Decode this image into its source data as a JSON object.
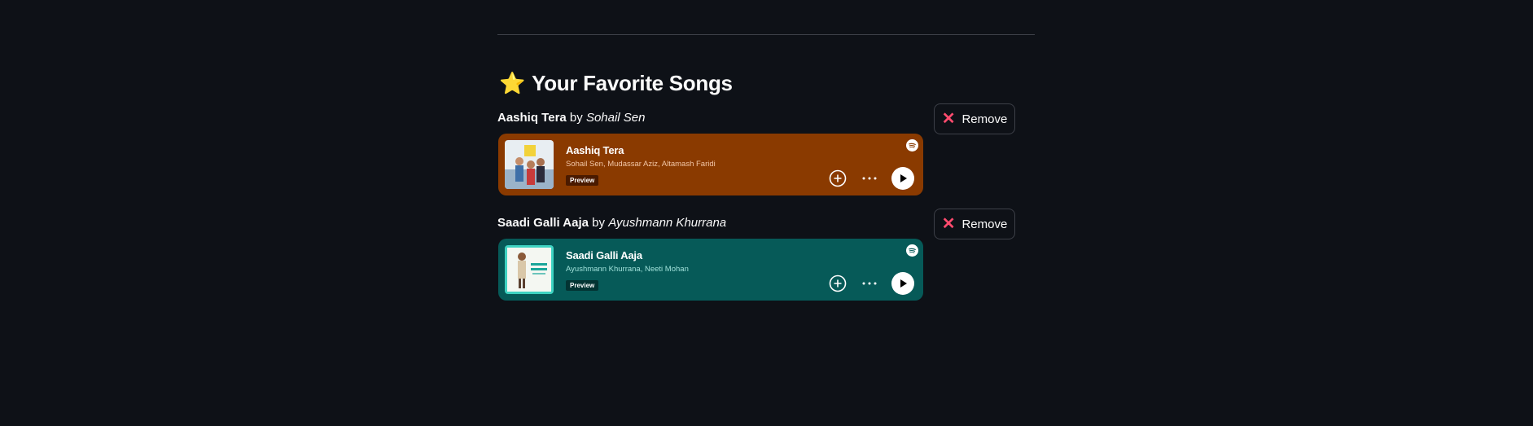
{
  "header": {
    "icon": "star-icon",
    "title": "Your Favorite Songs"
  },
  "songs": [
    {
      "name": "Aashiq Tera",
      "by_word": "by",
      "artist": "Sohail Sen",
      "remove_label": "Remove",
      "embed": {
        "title": "Aashiq Tera",
        "artists": "Sohail Sen, Mudassar Aziz, Altamash Faridi",
        "badge": "Preview",
        "background": "#8a3a00",
        "artist_color": "#f2c6a6",
        "badge_bg": "#4a1a00"
      }
    },
    {
      "name": "Saadi Galli Aaja",
      "by_word": "by",
      "artist": "Ayushmann Khurrana",
      "remove_label": "Remove",
      "embed": {
        "title": "Saadi Galli Aaja",
        "artists": "Ayushmann Khurrana, Neeti Mohan",
        "badge": "Preview",
        "background": "#065a58",
        "artist_color": "#9fe0d9",
        "badge_bg": "#033433"
      }
    }
  ],
  "colors": {
    "page_bg": "#0e1117",
    "remove_x": "#ff4b6e"
  }
}
